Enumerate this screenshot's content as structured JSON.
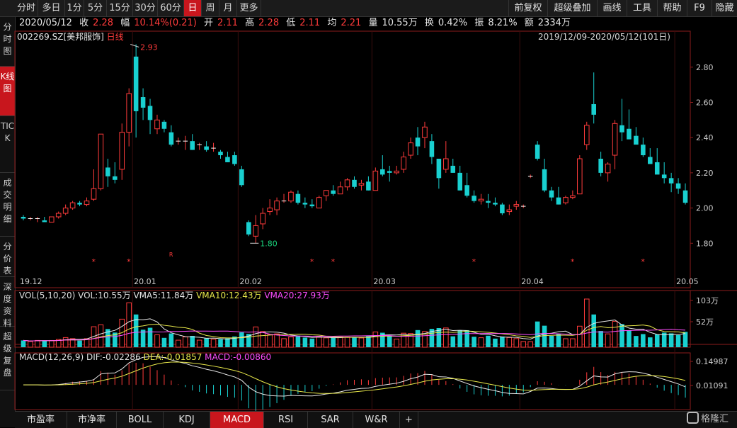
{
  "toolbar": {
    "left": [
      "分时",
      "多日",
      "1分",
      "5分",
      "15分",
      "30分",
      "60分",
      "日",
      "周",
      "月",
      "更多"
    ],
    "active": "日",
    "right": [
      "前复权",
      "超级叠加",
      "画线",
      "工具",
      "帮助",
      "F9",
      "隐藏"
    ]
  },
  "leftnav": {
    "items": [
      "分时图",
      "K线图",
      "TICK",
      "成交明细",
      "分价表",
      "深度资料",
      "超级复盘"
    ],
    "active": "K线图"
  },
  "info": {
    "date": "2020/05/12",
    "close_label": "收",
    "close": "2.28",
    "chg_label": "幅",
    "chg": "10.14%(0.21)",
    "open_label": "开",
    "open": "2.11",
    "high_label": "高",
    "high": "2.28",
    "low_label": "低",
    "low": "2.11",
    "avg_label": "均",
    "avg": "2.21",
    "vol_label": "量",
    "vol": "10.55万",
    "turn_label": "换",
    "turn": "0.42%",
    "amp_label": "振",
    "amp": "8.21%",
    "amt_label": "额",
    "amt": "2334万"
  },
  "stock": {
    "code": "002269.SZ",
    "name": "[美邦服饰]",
    "period": "日线"
  },
  "range_text": "2019/12/09-2020/05/12(101日)",
  "colors": {
    "up": "#ff3b3b",
    "down": "#19d0d0",
    "ma5": "#e8e8e8",
    "ma10": "#e8e84a",
    "ma20": "#ff4dff"
  },
  "chart_data": [
    {
      "type": "candlestick",
      "period": "日线",
      "ylim": [
        1.62,
        2.94
      ],
      "yticks": [
        1.8,
        2.0,
        2.2,
        2.4,
        2.6,
        2.8
      ],
      "xlabels": [
        {
          "label": "19.12",
          "i": 0
        },
        {
          "label": "20.01",
          "i": 16
        },
        {
          "label": "20.02",
          "i": 31
        },
        {
          "label": "20.03",
          "i": 50
        },
        {
          "label": "20.04",
          "i": 71
        },
        {
          "label": "20.05",
          "i": 93
        }
      ],
      "annotations": [
        {
          "text": "2.93",
          "i": 15,
          "price": 2.93,
          "type": "high"
        },
        {
          "text": "1.80",
          "i": 32,
          "price": 1.8,
          "type": "low"
        }
      ],
      "markers": [
        {
          "i": 10,
          "text": "*"
        },
        {
          "i": 15,
          "text": "*"
        },
        {
          "i": 21,
          "text": "R"
        },
        {
          "i": 41,
          "text": "*"
        },
        {
          "i": 44,
          "text": "*"
        },
        {
          "i": 64,
          "text": "*"
        },
        {
          "i": 78,
          "text": "*"
        },
        {
          "i": 88,
          "text": "*"
        }
      ],
      "ohlc": [
        [
          1.95,
          1.96,
          1.93,
          1.94
        ],
        [
          1.94,
          1.95,
          1.93,
          1.94
        ],
        [
          1.94,
          1.95,
          1.92,
          1.94
        ],
        [
          1.93,
          1.95,
          1.92,
          1.92
        ],
        [
          1.92,
          1.95,
          1.92,
          1.95
        ],
        [
          1.95,
          1.98,
          1.94,
          1.97
        ],
        [
          1.97,
          2.02,
          1.96,
          2.0
        ],
        [
          2.0,
          2.04,
          1.99,
          2.03
        ],
        [
          2.03,
          2.04,
          2.01,
          2.02
        ],
        [
          2.02,
          2.06,
          2.01,
          2.04
        ],
        [
          2.05,
          2.22,
          2.04,
          2.11
        ],
        [
          2.11,
          2.4,
          2.1,
          2.42
        ],
        [
          2.23,
          2.28,
          2.12,
          2.18
        ],
        [
          2.18,
          2.26,
          2.14,
          2.16
        ],
        [
          2.22,
          2.48,
          2.16,
          2.43
        ],
        [
          2.43,
          2.68,
          2.35,
          2.65
        ],
        [
          2.86,
          2.93,
          2.4,
          2.55
        ],
        [
          2.63,
          2.68,
          2.5,
          2.57
        ],
        [
          2.58,
          2.62,
          2.42,
          2.5
        ],
        [
          2.45,
          2.53,
          2.42,
          2.5
        ],
        [
          2.49,
          2.5,
          2.43,
          2.45
        ],
        [
          2.43,
          2.47,
          2.35,
          2.36
        ],
        [
          2.38,
          2.4,
          2.36,
          2.38
        ],
        [
          2.38,
          2.41,
          2.33,
          2.38
        ],
        [
          2.38,
          2.42,
          2.33,
          2.33
        ],
        [
          2.36,
          2.37,
          2.33,
          2.36
        ],
        [
          2.35,
          2.38,
          2.32,
          2.33
        ],
        [
          2.34,
          2.37,
          2.32,
          2.34
        ],
        [
          2.32,
          2.33,
          2.28,
          2.3
        ],
        [
          2.29,
          2.32,
          2.26,
          2.26
        ],
        [
          2.3,
          2.32,
          2.24,
          2.25
        ],
        [
          2.22,
          2.24,
          2.12,
          2.13
        ],
        [
          1.92,
          1.93,
          1.84,
          1.85
        ],
        [
          1.84,
          1.96,
          1.8,
          1.9
        ],
        [
          1.91,
          2.0,
          1.88,
          1.97
        ],
        [
          1.98,
          2.05,
          1.96,
          2.0
        ],
        [
          1.99,
          2.06,
          1.96,
          2.04
        ],
        [
          2.04,
          2.08,
          2.03,
          2.04
        ],
        [
          2.04,
          2.1,
          2.03,
          2.09
        ],
        [
          2.08,
          2.1,
          2.02,
          2.03
        ],
        [
          2.03,
          2.06,
          2.0,
          2.02
        ],
        [
          2.02,
          2.05,
          2.0,
          2.01
        ],
        [
          2.0,
          2.07,
          2.0,
          2.06
        ],
        [
          2.07,
          2.1,
          2.04,
          2.1
        ],
        [
          2.1,
          2.13,
          2.07,
          2.08
        ],
        [
          2.08,
          2.15,
          2.08,
          2.12
        ],
        [
          2.12,
          2.17,
          2.1,
          2.16
        ],
        [
          2.16,
          2.18,
          2.11,
          2.12
        ],
        [
          2.13,
          2.16,
          2.1,
          2.14
        ],
        [
          2.15,
          2.18,
          2.1,
          2.1
        ],
        [
          2.1,
          2.23,
          2.1,
          2.21
        ],
        [
          2.22,
          2.3,
          2.18,
          2.19
        ],
        [
          2.21,
          2.24,
          2.15,
          2.2
        ],
        [
          2.2,
          2.24,
          2.19,
          2.21
        ],
        [
          2.22,
          2.32,
          2.2,
          2.29
        ],
        [
          2.3,
          2.4,
          2.28,
          2.37
        ],
        [
          2.4,
          2.46,
          2.3,
          2.35
        ],
        [
          2.4,
          2.49,
          2.34,
          2.46
        ],
        [
          2.38,
          2.42,
          2.25,
          2.29
        ],
        [
          2.28,
          2.28,
          2.11,
          2.17
        ],
        [
          2.22,
          2.38,
          2.2,
          2.28
        ],
        [
          2.24,
          2.28,
          2.2,
          2.2
        ],
        [
          2.2,
          2.24,
          2.1,
          2.1
        ],
        [
          2.13,
          2.2,
          2.06,
          2.07
        ],
        [
          2.07,
          2.1,
          2.03,
          2.04
        ],
        [
          2.04,
          2.08,
          2.02,
          2.05
        ],
        [
          2.04,
          2.08,
          2.0,
          2.03
        ],
        [
          2.03,
          2.06,
          2.01,
          2.02
        ],
        [
          2.02,
          2.03,
          1.96,
          1.97
        ],
        [
          1.98,
          2.02,
          1.96,
          1.99
        ],
        [
          2.01,
          2.04,
          1.99,
          2.02
        ],
        [
          2.01,
          2.02,
          2.0,
          2.01
        ],
        [
          2.18,
          2.19,
          2.17,
          2.18
        ],
        [
          2.36,
          2.38,
          2.27,
          2.28
        ],
        [
          2.22,
          2.28,
          2.09,
          2.1
        ],
        [
          2.1,
          2.12,
          2.04,
          2.06
        ],
        [
          2.06,
          2.12,
          2.02,
          2.02
        ],
        [
          2.03,
          2.07,
          2.02,
          2.06
        ],
        [
          2.06,
          2.1,
          2.05,
          2.07
        ],
        [
          2.08,
          2.3,
          2.08,
          2.28
        ],
        [
          2.36,
          2.49,
          2.33,
          2.47
        ],
        [
          2.59,
          2.77,
          2.48,
          2.53
        ],
        [
          2.28,
          2.32,
          2.18,
          2.2
        ],
        [
          2.2,
          2.26,
          2.15,
          2.25
        ],
        [
          2.3,
          2.5,
          2.22,
          2.48
        ],
        [
          2.47,
          2.62,
          2.38,
          2.43
        ],
        [
          2.45,
          2.56,
          2.4,
          2.39
        ],
        [
          2.41,
          2.46,
          2.37,
          2.36
        ],
        [
          2.36,
          2.4,
          2.29,
          2.3
        ],
        [
          2.29,
          2.34,
          2.27,
          2.25
        ],
        [
          2.26,
          2.34,
          2.24,
          2.19
        ],
        [
          2.19,
          2.26,
          2.14,
          2.17
        ],
        [
          2.17,
          2.2,
          2.09,
          2.14
        ],
        [
          2.14,
          2.17,
          2.08,
          2.11
        ],
        [
          2.1,
          2.14,
          2.02,
          2.03
        ]
      ]
    },
    {
      "type": "bar",
      "title": "VOL(5,10,20)",
      "legend": [
        {
          "name": "VOL",
          "value": "10.55万"
        },
        {
          "name": "VMA5",
          "value": "11.84万"
        },
        {
          "name": "VMA10",
          "value": "12.43万"
        },
        {
          "name": "VMA20",
          "value": "27.93万"
        }
      ],
      "ylim": [
        0,
        103
      ],
      "yticks": [
        "103万",
        "52万"
      ],
      "series_hint": "volume bars derived per candle; MA lines from averages"
    },
    {
      "type": "bar",
      "title": "MACD(12,26,9)",
      "legend": [
        {
          "name": "DIF",
          "value": "-0.02286"
        },
        {
          "name": "DEA",
          "value": "-0.01857"
        },
        {
          "name": "MACD",
          "value": "-0.00860"
        }
      ],
      "yticks": [
        "0.14987",
        "0.01091"
      ]
    }
  ],
  "bottom_tabs": [
    "市盈率",
    "市净率",
    "BOLL",
    "KDJ",
    "MACD",
    "RSI",
    "SAR",
    "W&R",
    "+"
  ],
  "bottom_active": "MACD",
  "logo": "格隆汇"
}
